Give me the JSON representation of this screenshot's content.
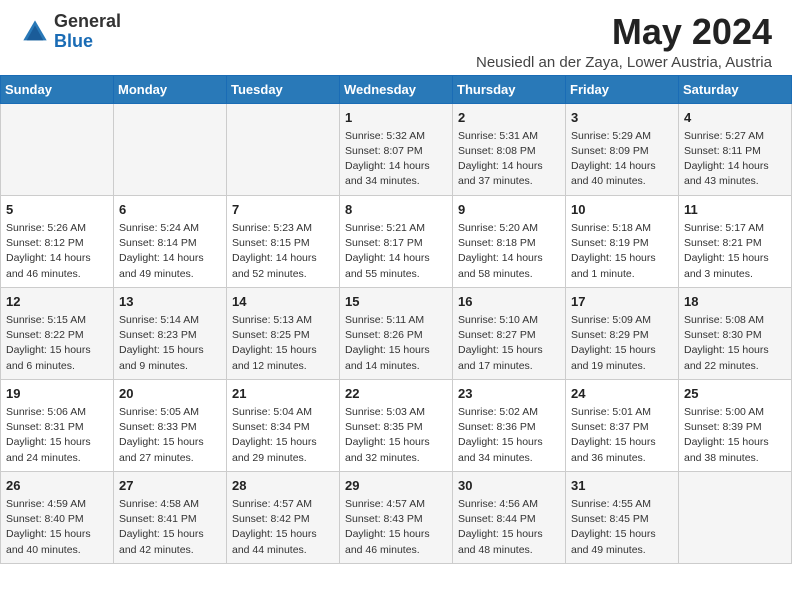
{
  "header": {
    "logo_general": "General",
    "logo_blue": "Blue",
    "month_year": "May 2024",
    "location": "Neusiedl an der Zaya, Lower Austria, Austria"
  },
  "weekdays": [
    "Sunday",
    "Monday",
    "Tuesday",
    "Wednesday",
    "Thursday",
    "Friday",
    "Saturday"
  ],
  "weeks": [
    [
      {
        "day": "",
        "info": ""
      },
      {
        "day": "",
        "info": ""
      },
      {
        "day": "",
        "info": ""
      },
      {
        "day": "1",
        "info": "Sunrise: 5:32 AM\nSunset: 8:07 PM\nDaylight: 14 hours\nand 34 minutes."
      },
      {
        "day": "2",
        "info": "Sunrise: 5:31 AM\nSunset: 8:08 PM\nDaylight: 14 hours\nand 37 minutes."
      },
      {
        "day": "3",
        "info": "Sunrise: 5:29 AM\nSunset: 8:09 PM\nDaylight: 14 hours\nand 40 minutes."
      },
      {
        "day": "4",
        "info": "Sunrise: 5:27 AM\nSunset: 8:11 PM\nDaylight: 14 hours\nand 43 minutes."
      }
    ],
    [
      {
        "day": "5",
        "info": "Sunrise: 5:26 AM\nSunset: 8:12 PM\nDaylight: 14 hours\nand 46 minutes."
      },
      {
        "day": "6",
        "info": "Sunrise: 5:24 AM\nSunset: 8:14 PM\nDaylight: 14 hours\nand 49 minutes."
      },
      {
        "day": "7",
        "info": "Sunrise: 5:23 AM\nSunset: 8:15 PM\nDaylight: 14 hours\nand 52 minutes."
      },
      {
        "day": "8",
        "info": "Sunrise: 5:21 AM\nSunset: 8:17 PM\nDaylight: 14 hours\nand 55 minutes."
      },
      {
        "day": "9",
        "info": "Sunrise: 5:20 AM\nSunset: 8:18 PM\nDaylight: 14 hours\nand 58 minutes."
      },
      {
        "day": "10",
        "info": "Sunrise: 5:18 AM\nSunset: 8:19 PM\nDaylight: 15 hours\nand 1 minute."
      },
      {
        "day": "11",
        "info": "Sunrise: 5:17 AM\nSunset: 8:21 PM\nDaylight: 15 hours\nand 3 minutes."
      }
    ],
    [
      {
        "day": "12",
        "info": "Sunrise: 5:15 AM\nSunset: 8:22 PM\nDaylight: 15 hours\nand 6 minutes."
      },
      {
        "day": "13",
        "info": "Sunrise: 5:14 AM\nSunset: 8:23 PM\nDaylight: 15 hours\nand 9 minutes."
      },
      {
        "day": "14",
        "info": "Sunrise: 5:13 AM\nSunset: 8:25 PM\nDaylight: 15 hours\nand 12 minutes."
      },
      {
        "day": "15",
        "info": "Sunrise: 5:11 AM\nSunset: 8:26 PM\nDaylight: 15 hours\nand 14 minutes."
      },
      {
        "day": "16",
        "info": "Sunrise: 5:10 AM\nSunset: 8:27 PM\nDaylight: 15 hours\nand 17 minutes."
      },
      {
        "day": "17",
        "info": "Sunrise: 5:09 AM\nSunset: 8:29 PM\nDaylight: 15 hours\nand 19 minutes."
      },
      {
        "day": "18",
        "info": "Sunrise: 5:08 AM\nSunset: 8:30 PM\nDaylight: 15 hours\nand 22 minutes."
      }
    ],
    [
      {
        "day": "19",
        "info": "Sunrise: 5:06 AM\nSunset: 8:31 PM\nDaylight: 15 hours\nand 24 minutes."
      },
      {
        "day": "20",
        "info": "Sunrise: 5:05 AM\nSunset: 8:33 PM\nDaylight: 15 hours\nand 27 minutes."
      },
      {
        "day": "21",
        "info": "Sunrise: 5:04 AM\nSunset: 8:34 PM\nDaylight: 15 hours\nand 29 minutes."
      },
      {
        "day": "22",
        "info": "Sunrise: 5:03 AM\nSunset: 8:35 PM\nDaylight: 15 hours\nand 32 minutes."
      },
      {
        "day": "23",
        "info": "Sunrise: 5:02 AM\nSunset: 8:36 PM\nDaylight: 15 hours\nand 34 minutes."
      },
      {
        "day": "24",
        "info": "Sunrise: 5:01 AM\nSunset: 8:37 PM\nDaylight: 15 hours\nand 36 minutes."
      },
      {
        "day": "25",
        "info": "Sunrise: 5:00 AM\nSunset: 8:39 PM\nDaylight: 15 hours\nand 38 minutes."
      }
    ],
    [
      {
        "day": "26",
        "info": "Sunrise: 4:59 AM\nSunset: 8:40 PM\nDaylight: 15 hours\nand 40 minutes."
      },
      {
        "day": "27",
        "info": "Sunrise: 4:58 AM\nSunset: 8:41 PM\nDaylight: 15 hours\nand 42 minutes."
      },
      {
        "day": "28",
        "info": "Sunrise: 4:57 AM\nSunset: 8:42 PM\nDaylight: 15 hours\nand 44 minutes."
      },
      {
        "day": "29",
        "info": "Sunrise: 4:57 AM\nSunset: 8:43 PM\nDaylight: 15 hours\nand 46 minutes."
      },
      {
        "day": "30",
        "info": "Sunrise: 4:56 AM\nSunset: 8:44 PM\nDaylight: 15 hours\nand 48 minutes."
      },
      {
        "day": "31",
        "info": "Sunrise: 4:55 AM\nSunset: 8:45 PM\nDaylight: 15 hours\nand 49 minutes."
      },
      {
        "day": "",
        "info": ""
      }
    ]
  ]
}
